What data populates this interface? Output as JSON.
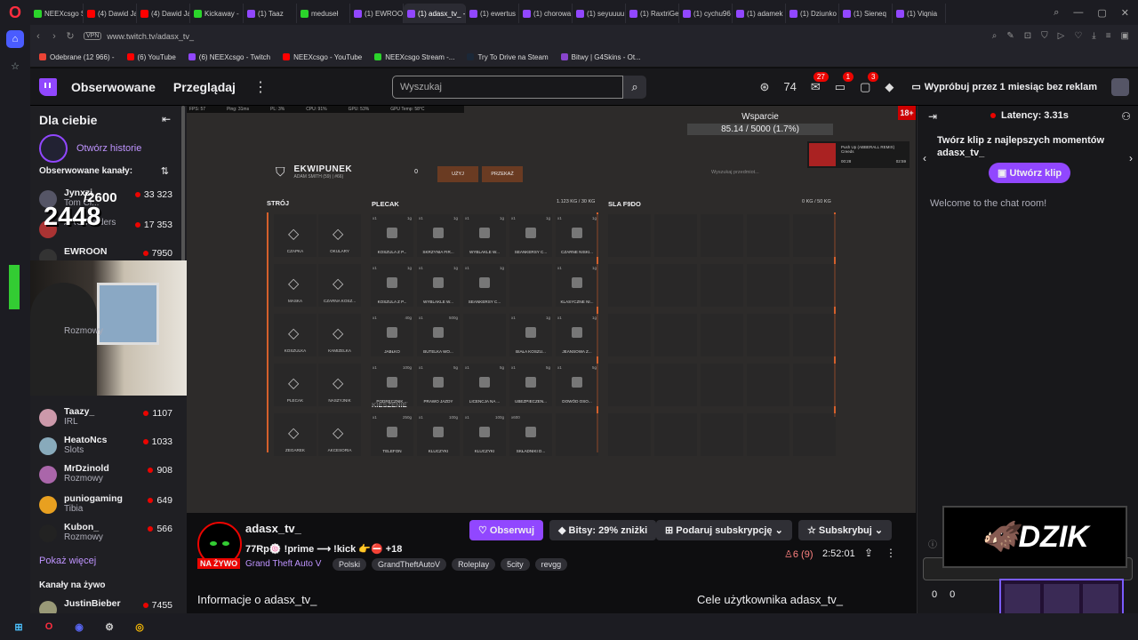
{
  "browser": {
    "tabs": [
      {
        "label": "NEEXcsgo S",
        "color": "#2bd42b"
      },
      {
        "label": "(4) Dawid Ja",
        "color": "#ff0000"
      },
      {
        "label": "(4) Dawid Ja",
        "color": "#ff0000"
      },
      {
        "label": "Kickaway -",
        "color": "#2bd42b"
      },
      {
        "label": "(1) Taaz",
        "color": "#9147ff"
      },
      {
        "label": "meduseł",
        "color": "#2bd42b"
      },
      {
        "label": "(1) EWROO",
        "color": "#9147ff"
      },
      {
        "label": "(1) adasx_tv_ -",
        "color": "#9147ff"
      },
      {
        "label": "(1) ewertus",
        "color": "#9147ff"
      },
      {
        "label": "(1) chorowa",
        "color": "#9147ff"
      },
      {
        "label": "(1) seyuuuu",
        "color": "#9147ff"
      },
      {
        "label": "(1) RaxtriGe",
        "color": "#9147ff"
      },
      {
        "label": "(1) cychu96",
        "color": "#9147ff"
      },
      {
        "label": "(1) adamek",
        "color": "#9147ff"
      },
      {
        "label": "(1) Dziunko",
        "color": "#9147ff"
      },
      {
        "label": "(1) Sieneq",
        "color": "#9147ff"
      },
      {
        "label": "(1) Viqnia",
        "color": "#9147ff"
      }
    ],
    "active_tab_index": 7,
    "url": "www.twitch.tv/adasx_tv_",
    "vpn": "VPN",
    "bookmarks": [
      {
        "label": "Odebrane (12 966) -",
        "color": "#ea4335"
      },
      {
        "label": "(6) YouTube",
        "color": "#ff0000"
      },
      {
        "label": "(6) NEEXcsgo - Twitch",
        "color": "#9147ff"
      },
      {
        "label": "NEEXcsgo - YouTube",
        "color": "#ff0000"
      },
      {
        "label": "NEEXcsgo Stream -...",
        "color": "#2bd42b"
      },
      {
        "label": "Try To Drive na Steam",
        "color": "#1b2838"
      },
      {
        "label": "Bitwy | G4Skins - Ot...",
        "color": "#8844cc"
      }
    ]
  },
  "topnav": {
    "following": "Obserwowane",
    "browse": "Przeglądaj",
    "search_placeholder": "Wyszukaj",
    "badges": [
      "27",
      "1",
      "3"
    ],
    "promo": "Wypróbuj przez 1 miesiąc bez reklam"
  },
  "left_nav": {
    "title": "Dla ciebie",
    "history": "Otwórz historie",
    "followed_title": "Obserwowane kanały:",
    "channels": [
      {
        "name": "Jynxzi",
        "game": "Tom Cl...",
        "viewers": "33 323",
        "color": "#556"
      },
      {
        "name": "",
        "game": "ARC Raiders",
        "viewers": "17 353",
        "color": "#a33"
      },
      {
        "name": "EWROON",
        "game": "",
        "viewers": "7950",
        "color": "#333"
      },
      {
        "name": "Taazy_",
        "game": "IRL",
        "viewers": "1107",
        "color": "#c9a"
      },
      {
        "name": "HeatoNcs",
        "game": "Slots",
        "viewers": "1033",
        "color": "#8ab"
      },
      {
        "name": "MrDzinold",
        "game": "Rozmowy",
        "viewers": "908",
        "color": "#a6a"
      },
      {
        "name": "puniogaming",
        "game": "Tibia",
        "viewers": "649",
        "color": "#e8a020"
      },
      {
        "name": "Kubon_",
        "game": "Rozmowy",
        "viewers": "566",
        "color": "#222"
      }
    ],
    "partial_game": "Rozmowy",
    "show_more": "Pokaż więcej",
    "live_title": "Kanały na żywo",
    "live_channel": {
      "name": "JustinBieber",
      "viewers": "7455"
    }
  },
  "player": {
    "stats": [
      "FPS: 57",
      "Ping: 31ms",
      "PL: 3%",
      "CPU: 91%",
      "GPU: 53%",
      "GPU Temp: 58°C"
    ],
    "donation_title": "Wsparcie",
    "donation_value": "85.14 / 5000 (1.7%)",
    "age": "18+",
    "music_title": "Push Up (ABBERALL REMIX)",
    "music_artist": "Creeds",
    "music_time_start": "00:28",
    "music_time_end": "02:59",
    "viewers_small": "2600",
    "viewers_big": "2448",
    "inventory": {
      "title": "EKWIPUNEK",
      "subtitle": "ADAM SMITH (59) | #66)",
      "count": "0",
      "use": "UŻYJ",
      "give": "PRZEKAŻ",
      "search": "Wyszukaj przedmiot...",
      "outfit_title": "STRÓJ",
      "backpack_title": "PLECAK",
      "backpack_weight": "1.123 KG",
      "backpack_capacity": "/ 30 KG",
      "other_title": "SLA F9DO",
      "other_weight": "0 KG",
      "other_capacity": "/ 50 KG",
      "pockets_title": "KIESZENIE",
      "gear": [
        "CZAPKA",
        "OKULARY",
        "MASKA",
        "CZARNA KOSZ...",
        "KOSZULKA",
        "KAMIZELKA",
        "PLECAK",
        "NASZYJNIK",
        "ZEGAREK",
        "AKCESORIA"
      ],
      "backpack_items": [
        {
          "q": "x1",
          "w": "1g",
          "name": "KOSZULA Z P..."
        },
        {
          "q": "x1",
          "w": "1g",
          "name": "SKRZYNIA FIR..."
        },
        {
          "q": "x1",
          "w": "1g",
          "name": "WYBLAKLE W..."
        },
        {
          "q": "x1",
          "w": "1g",
          "name": "SEANKERSY C..."
        },
        {
          "q": "x1",
          "w": "1g",
          "name": "CZARNE NISKI..."
        },
        {
          "q": "x1",
          "w": "1g",
          "name": "KOSZULA Z P..."
        },
        {
          "q": "x1",
          "w": "1g",
          "name": "WYBLAKLE W..."
        },
        {
          "q": "x1",
          "w": "1g",
          "name": "SEANKERSY C..."
        },
        {
          "q": "",
          "w": "",
          "name": ""
        },
        {
          "q": "x1",
          "w": "1g",
          "name": "KLASYCZNE NI..."
        },
        {
          "q": "x1",
          "w": "40g",
          "name": "JABŁKO"
        },
        {
          "q": "x1",
          "w": "500g",
          "name": "BUTELKA WO..."
        },
        {
          "q": "",
          "w": "",
          "name": ""
        },
        {
          "q": "x1",
          "w": "1g",
          "name": "BIAŁA KOSZU..."
        },
        {
          "q": "x1",
          "w": "1g",
          "name": "JEANSOWA Z..."
        },
        {
          "q": "x1",
          "w": "100g",
          "name": "PODRĘCZNIK ..."
        },
        {
          "q": "x1",
          "w": "5g",
          "name": "PRAWO JAZDY"
        },
        {
          "q": "x1",
          "w": "5g",
          "name": "LICENCJA NA ..."
        },
        {
          "q": "x1",
          "w": "5g",
          "name": "UBEZPIECZEN..."
        },
        {
          "q": "x1",
          "w": "5g",
          "name": "DOWÓD OSO..."
        }
      ],
      "pocket_items": [
        {
          "q": "x1",
          "w": "250g",
          "name": "TELEFON"
        },
        {
          "q": "x1",
          "w": "100g",
          "name": "KLUCZYKI"
        },
        {
          "q": "x1",
          "w": "100g",
          "name": "KLUCZYKI"
        },
        {
          "q": "x600",
          "w": "",
          "name": "SKŁADNIKI D..."
        },
        {
          "q": "",
          "w": "",
          "name": ""
        }
      ]
    }
  },
  "stream_info": {
    "channel": "adasx_tv_",
    "title": "77Rp🍥 !prime ⟶ !kick 👉⛔ +18",
    "live": "NA ŻYWO",
    "game": "Grand Theft Auto V",
    "tags": [
      "Polski",
      "GrandTheftAutoV",
      "Roleplay",
      "5city",
      "revgg"
    ],
    "follow": "Obserwuj",
    "bits": "Bitsy: 29% zniżki",
    "gift": "Podaruj subskrypcję",
    "subscribe": "Subskrybuj",
    "viewers": "6 (9)",
    "uptime": "2:52:01",
    "about": "Informacje o adasx_tv_",
    "goals": "Cele użytkownika adasx_tv_"
  },
  "chat": {
    "latency": "Latency: 3.31s",
    "clip_text": "Twórz klip z najlepszych momentów adasx_tv_",
    "clip_button": "Utwórz klip",
    "welcome": "Welcome to the chat room!",
    "dzik": "DZIK",
    "points": [
      "0",
      "0"
    ]
  }
}
